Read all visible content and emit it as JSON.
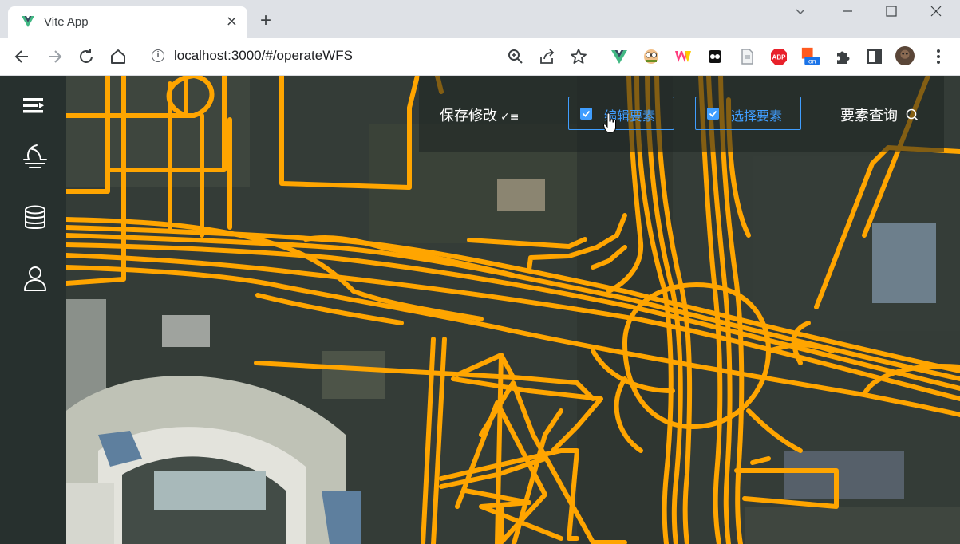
{
  "browser": {
    "tab_title": "Vite App",
    "tab_close": "×",
    "new_tab": "+",
    "url": "localhost:3000/#/operateWFS",
    "window_controls": {
      "minimize": "—",
      "maximize": "☐",
      "close": "✕"
    },
    "extensions": [
      "vue-devtools-icon",
      "face-extension-icon",
      "w-extension-icon",
      "ghost-extension-icon",
      "doc-extension-icon",
      "adblock-icon",
      "onoff-extension-icon",
      "puzzle-extensions-icon",
      "side-panel-icon",
      "profile-avatar",
      "kebab-menu-icon"
    ],
    "adblock_label": "ABP",
    "onoff_label": "on"
  },
  "sidebar": {
    "items": [
      {
        "name": "menu-toggle",
        "icon": "menu-fold-icon"
      },
      {
        "name": "weather",
        "icon": "moon-weather-icon"
      },
      {
        "name": "database",
        "icon": "database-icon"
      },
      {
        "name": "user",
        "icon": "user-icon"
      }
    ]
  },
  "toolbar": {
    "save_label": "保存修改",
    "save_icon": "✓≡",
    "edit_label": "编辑要素",
    "edit_checked": true,
    "select_label": "选择要素",
    "select_checked": true,
    "query_label": "要素查询",
    "query_icon": "search-icon"
  },
  "colors": {
    "road": "#ffa500",
    "accent": "#409eff",
    "sidebar_bg": "#27302e",
    "map_bg": "#333b36"
  }
}
